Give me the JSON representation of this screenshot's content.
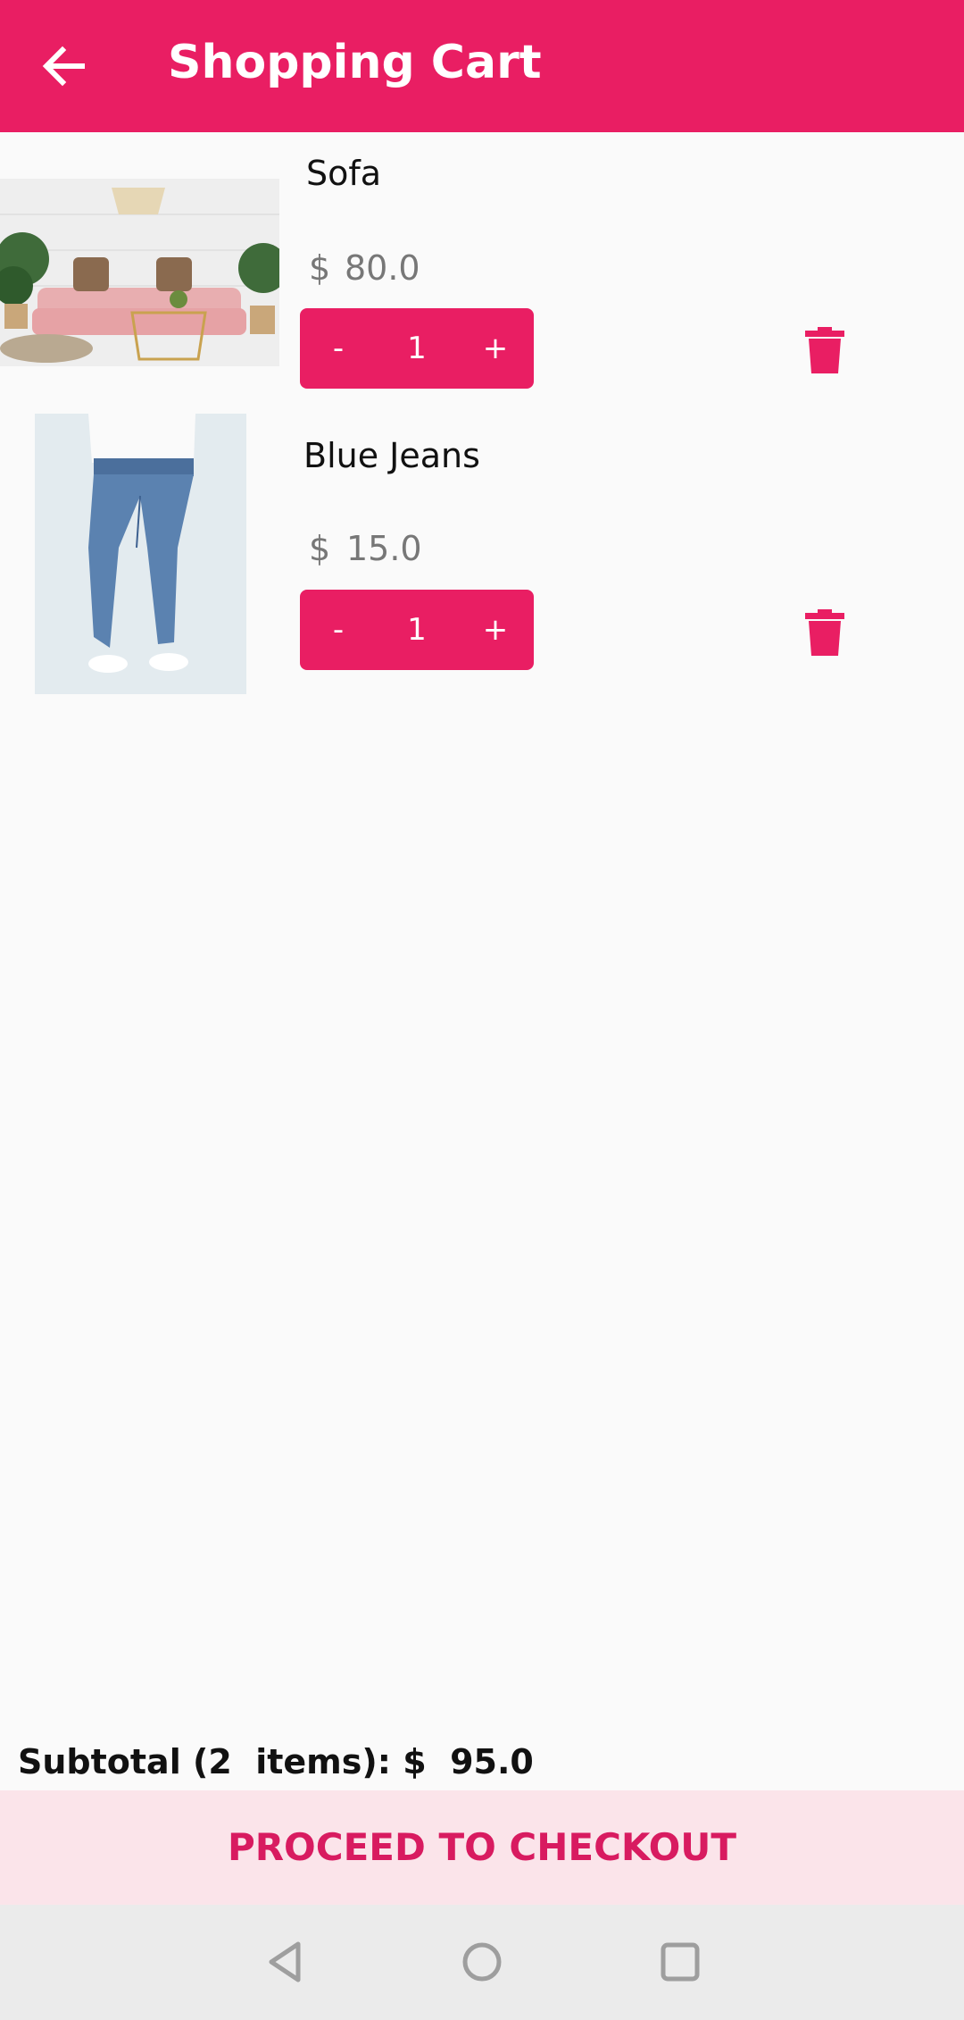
{
  "appbar": {
    "title": "Shopping Cart",
    "back_icon": "arrow-back-icon"
  },
  "cart": {
    "currency": "$",
    "items": [
      {
        "name": "Sofa",
        "price": "80.0",
        "quantity": "1",
        "minus": "-",
        "plus": "+",
        "image": "sofa-photo"
      },
      {
        "name": "Blue Jeans",
        "price": "15.0",
        "quantity": "1",
        "minus": "-",
        "plus": "+",
        "image": "jeans-photo"
      }
    ]
  },
  "footer": {
    "subtotal_text": "Subtotal (2  items): $  95.0",
    "checkout_label": "PROCEED TO CHECKOUT"
  },
  "navbar": {
    "icons": [
      "back-nav-icon",
      "home-nav-icon",
      "recents-nav-icon"
    ]
  },
  "colors": {
    "accent": "#e91e63",
    "checkout_bg": "#fbe4ea"
  }
}
